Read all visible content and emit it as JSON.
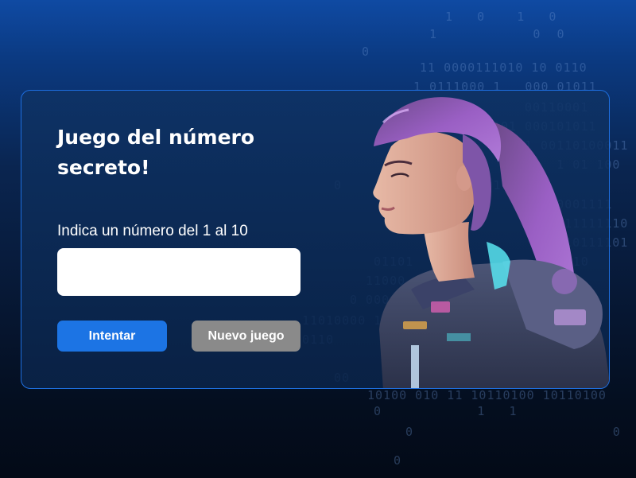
{
  "game": {
    "title": "Juego del número secreto!",
    "prompt": "Indica un número del 1 al 10",
    "input_value": "",
    "try_button": "Intentar",
    "new_game_button": "Nuevo juego"
  },
  "colors": {
    "background_top": "#0f4aa3",
    "background_bottom": "#030a17",
    "card_border": "#1e6fe0",
    "primary_button": "#1c74e4",
    "secondary_button": "#8a8a8a"
  },
  "illustration": "astronaut-woman-purple-hair"
}
